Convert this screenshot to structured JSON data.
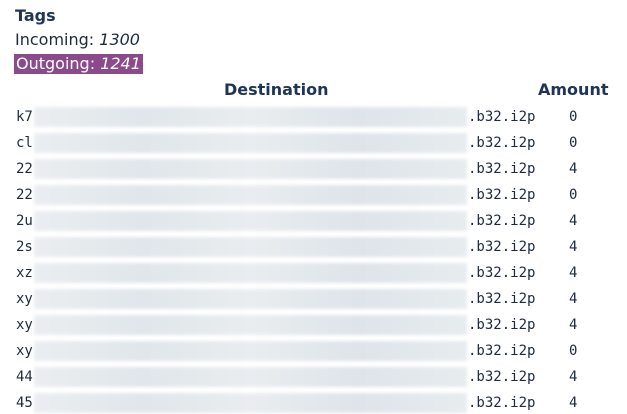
{
  "tags": {
    "title": "Tags",
    "incoming_label": "Incoming:",
    "incoming_value": "1300",
    "outgoing_label": "Outgoing:",
    "outgoing_value": "1241",
    "outgoing_highlight_color": "#8a4a8c"
  },
  "table": {
    "col_destination": "Destination",
    "col_amount": "Amount",
    "suffix": ".b32.i2p",
    "rows": [
      {
        "prefix": "k7",
        "amount": "0"
      },
      {
        "prefix": "cl",
        "amount": "0"
      },
      {
        "prefix": "22",
        "amount": "4"
      },
      {
        "prefix": "22",
        "amount": "0"
      },
      {
        "prefix": "2u",
        "amount": "4"
      },
      {
        "prefix": "2s",
        "amount": "4"
      },
      {
        "prefix": "xz",
        "amount": "4"
      },
      {
        "prefix": "xy",
        "amount": "4"
      },
      {
        "prefix": "xy",
        "amount": "4"
      },
      {
        "prefix": "xy",
        "amount": "0"
      },
      {
        "prefix": "44",
        "amount": "4"
      },
      {
        "prefix": "45",
        "amount": "4"
      }
    ]
  }
}
